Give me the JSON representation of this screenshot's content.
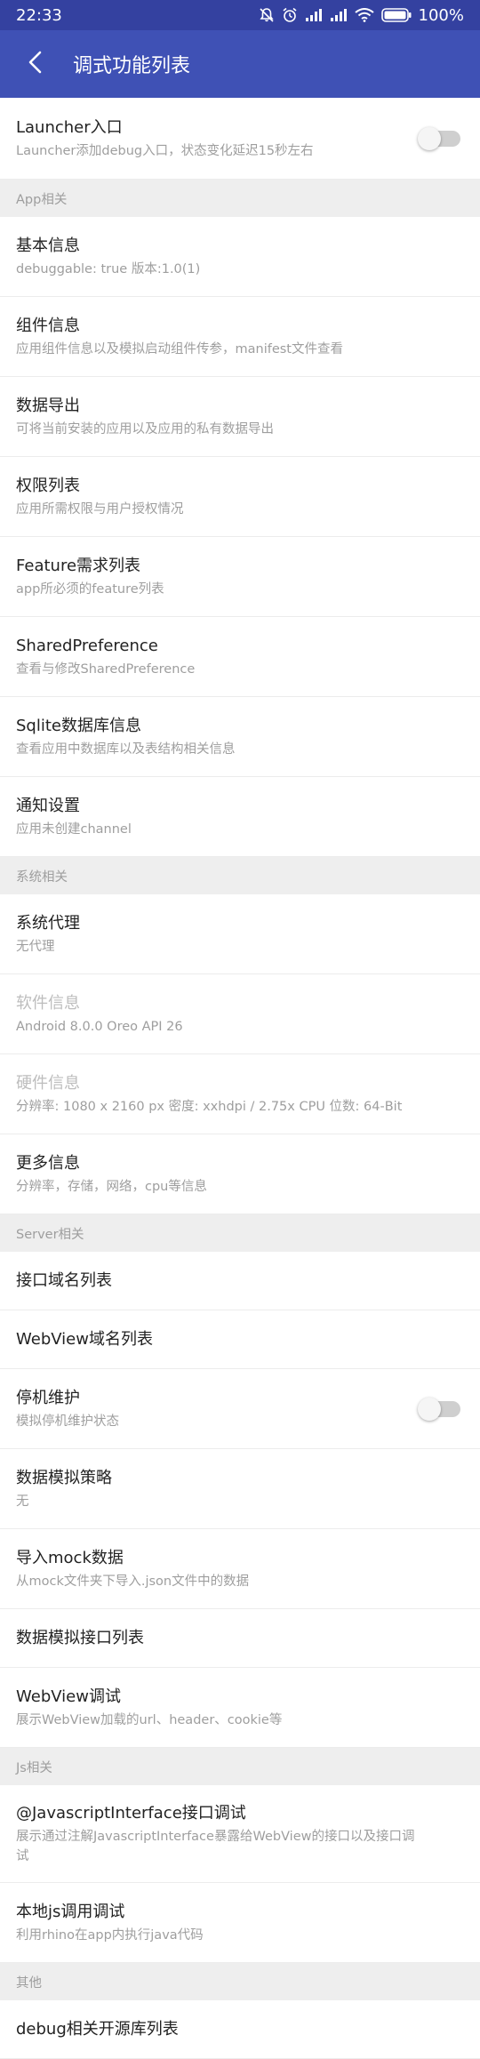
{
  "status_bar": {
    "time": "22:33",
    "battery": "100%",
    "icons": [
      "muted-bell-icon",
      "alarm-icon",
      "signal-icon",
      "signal-icon",
      "wifi-icon",
      "battery-icon"
    ]
  },
  "app_bar": {
    "title": "调式功能列表",
    "back_icon": "back-arrow-icon",
    "color": "#3f51b5"
  },
  "launcher": {
    "title": "Launcher入口",
    "subtitle": "Launcher添加debug入口，状态变化延迟15秒左右",
    "toggle_on": false
  },
  "sections": {
    "app": "App相关",
    "system": "系统相关",
    "server": "Server相关",
    "js": "Js相关",
    "other": "其他"
  },
  "app_items": [
    {
      "title": "基本信息",
      "subtitle": "debuggable: true    版本:1.0(1)"
    },
    {
      "title": "组件信息",
      "subtitle": "应用组件信息以及模拟启动组件传参，manifest文件查看"
    },
    {
      "title": "数据导出",
      "subtitle": "可将当前安装的应用以及应用的私有数据导出"
    },
    {
      "title": "权限列表",
      "subtitle": "应用所需权限与用户授权情况"
    },
    {
      "title": "Feature需求列表",
      "subtitle": "app所必须的feature列表"
    },
    {
      "title": "SharedPreference",
      "subtitle": "查看与修改SharedPreference"
    },
    {
      "title": "Sqlite数据库信息",
      "subtitle": "查看应用中数据库以及表结构相关信息"
    },
    {
      "title": "通知设置",
      "subtitle": "应用未创建channel"
    }
  ],
  "system_items": [
    {
      "title": "系统代理",
      "subtitle": "无代理"
    },
    {
      "title": "软件信息",
      "subtitle": "Android 8.0.0    Oreo    API 26"
    },
    {
      "title": "硬件信息",
      "subtitle": "分辨率: 1080 x 2160 px    密度: xxhdpi / 2.75x    CPU 位数: 64-Bit"
    },
    {
      "title": "更多信息",
      "subtitle": "分辨率，存储，网络，cpu等信息"
    }
  ],
  "server_items": [
    {
      "title": "接口域名列表"
    },
    {
      "title": "WebView域名列表"
    },
    {
      "title": "停机维护",
      "subtitle": "模拟停机维护状态",
      "toggle_on": false
    },
    {
      "title": "数据模拟策略",
      "subtitle": "无"
    },
    {
      "title": "导入mock数据",
      "subtitle": "从mock文件夹下导入.json文件中的数据"
    },
    {
      "title": "数据模拟接口列表"
    },
    {
      "title": "WebView调试",
      "subtitle": "展示WebView加载的url、header、cookie等"
    }
  ],
  "js_items": [
    {
      "title": "@JavascriptInterface接口调试",
      "subtitle_line1": "展示通过注解JavascriptInterface暴露给WebView的接口以及接口调",
      "subtitle_line2": "试"
    },
    {
      "title": "本地js调用调试",
      "subtitle": "利用rhino在app内执行java代码"
    }
  ],
  "other_items": [
    {
      "title": "debug相关开源库列表"
    }
  ]
}
